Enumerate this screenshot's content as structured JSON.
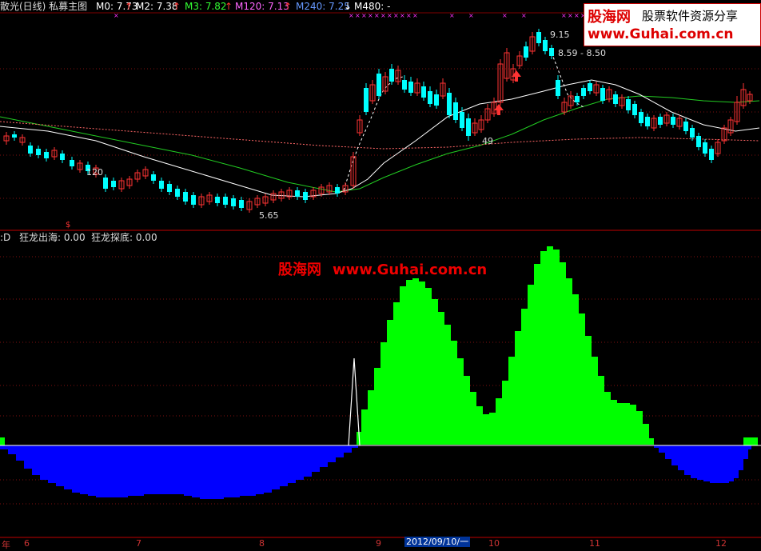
{
  "header": {
    "title": "散光(日线) 私募主图",
    "ma": [
      {
        "label": "M0: 7.73",
        "arrow": "↑",
        "color": "#ffffff"
      },
      {
        "label": "M2: 7.38",
        "arrow": "↑",
        "color": "#ffffff"
      },
      {
        "label": "M3: 7.82",
        "arrow": "↑",
        "color": "#33ff33"
      },
      {
        "label": "M120: 7.13",
        "arrow": "↑",
        "color": "#ff66ff"
      },
      {
        "label": "M240: 7.25",
        "arrow": "↓",
        "color": "#6699ff"
      },
      {
        "label": "M480: -",
        "arrow": "",
        "color": "#ffffff"
      }
    ]
  },
  "sub_header": {
    "prefix": ":D",
    "items": [
      "狂龙出海: 0.00",
      "狂龙探底: 0.00"
    ]
  },
  "logo": {
    "name": "股海网",
    "slogan": "股票软件资源分享",
    "url": "www.Guhai.com.cn"
  },
  "watermark": {
    "name": "股海网",
    "url": "www.Guhai.com.cn"
  },
  "annotations": {
    "high": "9.15",
    "range": "8.59 - 8.50",
    "low": "5.65",
    "mid": "49",
    "left": "120"
  },
  "x_axis": {
    "ticks": [
      "年",
      "6",
      "7",
      "8",
      "9",
      "10",
      "11",
      "12"
    ],
    "cursor_date": "2012/09/10/一"
  },
  "colors": {
    "up": "#ff3333",
    "down": "#00ffff",
    "ma_white": "#ffffff",
    "ma_green": "#22cc22",
    "ma_pink": "#ff6666",
    "green_area": "#00ff00",
    "blue_area": "#0000ff",
    "marker": "#ff33ff"
  }
}
